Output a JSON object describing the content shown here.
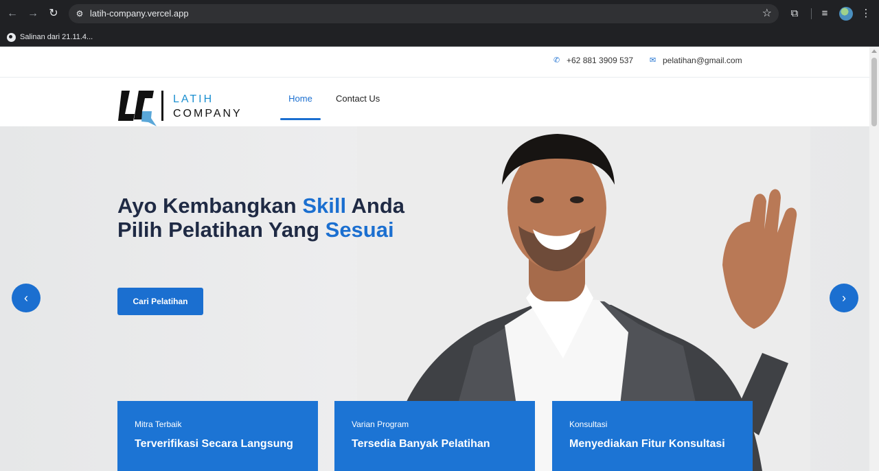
{
  "browser": {
    "url": "latih-company.vercel.app",
    "bookmark": "Salinan dari 21.11.4..."
  },
  "topbar": {
    "phone": "+62 881 3909 537",
    "email": "pelatihan@gmail.com"
  },
  "navbar": {
    "logo_line1": "LATIH",
    "logo_line2": "COMPANY",
    "home": "Home",
    "contact": "Contact Us"
  },
  "hero": {
    "headline_part1": "Ayo Kembangkan ",
    "headline_highlight1": "Skill",
    "headline_part2": " Anda",
    "headline_part3": "Pilih Pelatihan Yang ",
    "headline_highlight2": "Sesuai",
    "cta": "Cari Pelatihan",
    "arrow_left": "‹",
    "arrow_right": "›"
  },
  "cards": [
    {
      "eyebrow": "Mitra Terbaik",
      "title": "Terverifikasi Secara Langsung"
    },
    {
      "eyebrow": "Varian Program",
      "title": "Tersedia Banyak Pelatihan"
    },
    {
      "eyebrow": "Konsultasi",
      "title": "Menyediakan Fitur Konsultasi"
    }
  ],
  "colors": {
    "brand": "#1b6fd0",
    "card": "#1c74d4",
    "headline": "#1f2a44"
  }
}
